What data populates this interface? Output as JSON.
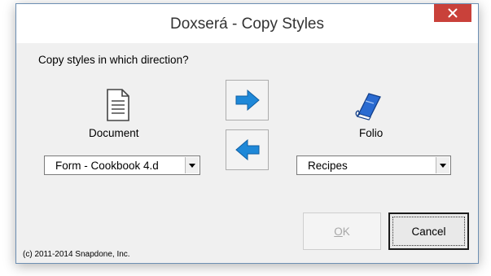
{
  "window": {
    "title": "Doxserá - Copy Styles",
    "close_icon": "close-icon"
  },
  "prompt": "Copy styles in which direction?",
  "document": {
    "icon": "document-icon",
    "label": "Document",
    "selected": "Form - Cookbook 4.d"
  },
  "folio": {
    "icon": "book-icon",
    "label": "Folio",
    "selected": "Recipes"
  },
  "arrows": {
    "right_icon": "arrow-right-icon",
    "left_icon": "arrow-left-icon"
  },
  "buttons": {
    "ok_mnemonic": "O",
    "ok_rest": "K",
    "ok_enabled": false,
    "cancel": "Cancel"
  },
  "copyright": "(c) 2011-2014 Snapdone, Inc.",
  "colors": {
    "close": "#c9413a",
    "arrow": "#1e88d8",
    "book": "#2a6bd1",
    "dialog_bg": "#f0f0f0"
  }
}
